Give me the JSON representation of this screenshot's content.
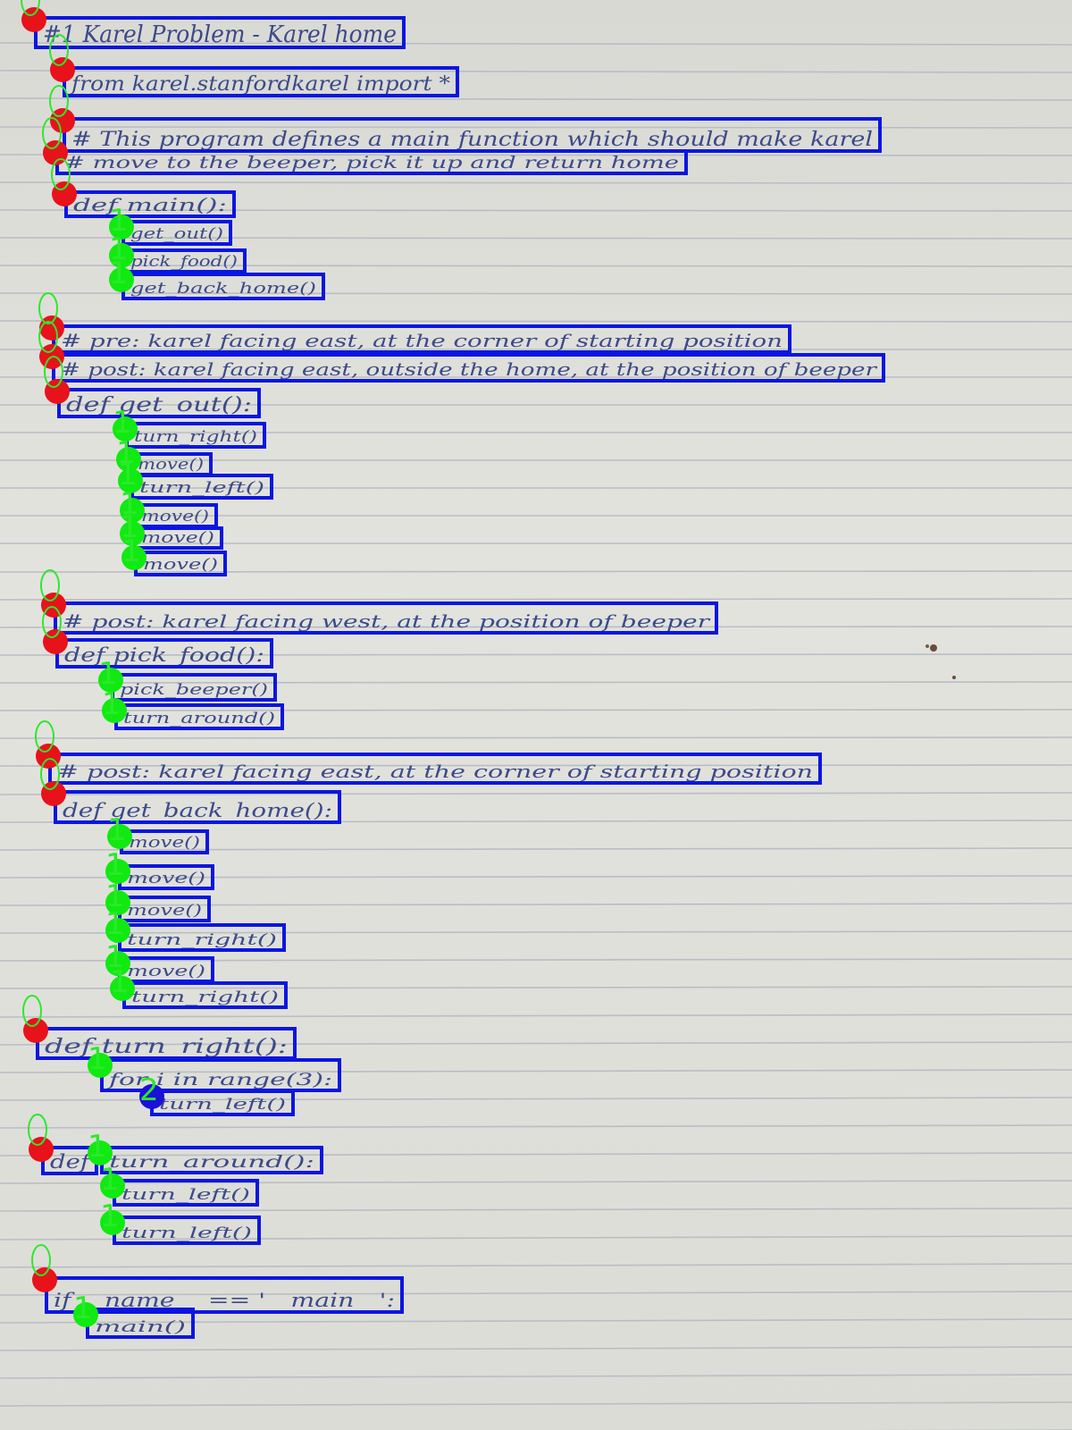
{
  "lines": [
    {
      "text": "#1 Karel Problem - Karel home",
      "level": 0
    },
    {
      "text": "from karel.stanfordkarel import *",
      "level": 0
    },
    {
      "text": "# This program defines a main function which should make karel",
      "level": 0
    },
    {
      "text": "# move to the beeper, pick it up and return home",
      "level": 0
    },
    {
      "text": "def main():",
      "level": 0
    },
    {
      "text": "get_out()",
      "level": 1
    },
    {
      "text": "pick_food()",
      "level": 1
    },
    {
      "text": "get_back_home()",
      "level": 1
    },
    {
      "text": "# pre: karel facing east, at the corner of starting position",
      "level": 0
    },
    {
      "text": "# post: karel facing east, outside the home, at the position of beeper",
      "level": 0
    },
    {
      "text": "def get_out():",
      "level": 0
    },
    {
      "text": "turn_right()",
      "level": 1
    },
    {
      "text": "move()",
      "level": 1
    },
    {
      "text": "turn_left()",
      "level": 1
    },
    {
      "text": "move()",
      "level": 1
    },
    {
      "text": "move()",
      "level": 1
    },
    {
      "text": "move()",
      "level": 1
    },
    {
      "text": "# post: karel facing west, at the position of beeper",
      "level": 0
    },
    {
      "text": "def pick_food():",
      "level": 0
    },
    {
      "text": "pick_beeper()",
      "level": 1
    },
    {
      "text": "turn_around()",
      "level": 1
    },
    {
      "text": "# post: karel facing east, at the corner of starting position",
      "level": 0
    },
    {
      "text": "def get_back_home():",
      "level": 0
    },
    {
      "text": "move()",
      "level": 1
    },
    {
      "text": "move()",
      "level": 1
    },
    {
      "text": "move()",
      "level": 1
    },
    {
      "text": "turn_right()",
      "level": 1
    },
    {
      "text": "move()",
      "level": 1
    },
    {
      "text": "turn_right()",
      "level": 1
    },
    {
      "text": "def turn_right():",
      "level": 0
    },
    {
      "text": "for i in range(3):",
      "level": 1
    },
    {
      "text": "turn_left()",
      "level": 2
    },
    {
      "text": "def",
      "level": 0
    },
    {
      "text": "turn_around():",
      "level": 1
    },
    {
      "text": "turn_left()",
      "level": 1
    },
    {
      "text": "turn_left()",
      "level": 1
    },
    {
      "text": "if __name__ == '__main__':",
      "level": 0
    },
    {
      "text": "main()",
      "level": 1
    }
  ],
  "colors": {
    "box": "#0a16e0",
    "level_0_marker": "#e8121b",
    "level_1_marker": "#10ea10",
    "level_2_marker": "#1a10d8",
    "ink": "#3c4a8a",
    "ruling": "#b9bdc4"
  }
}
